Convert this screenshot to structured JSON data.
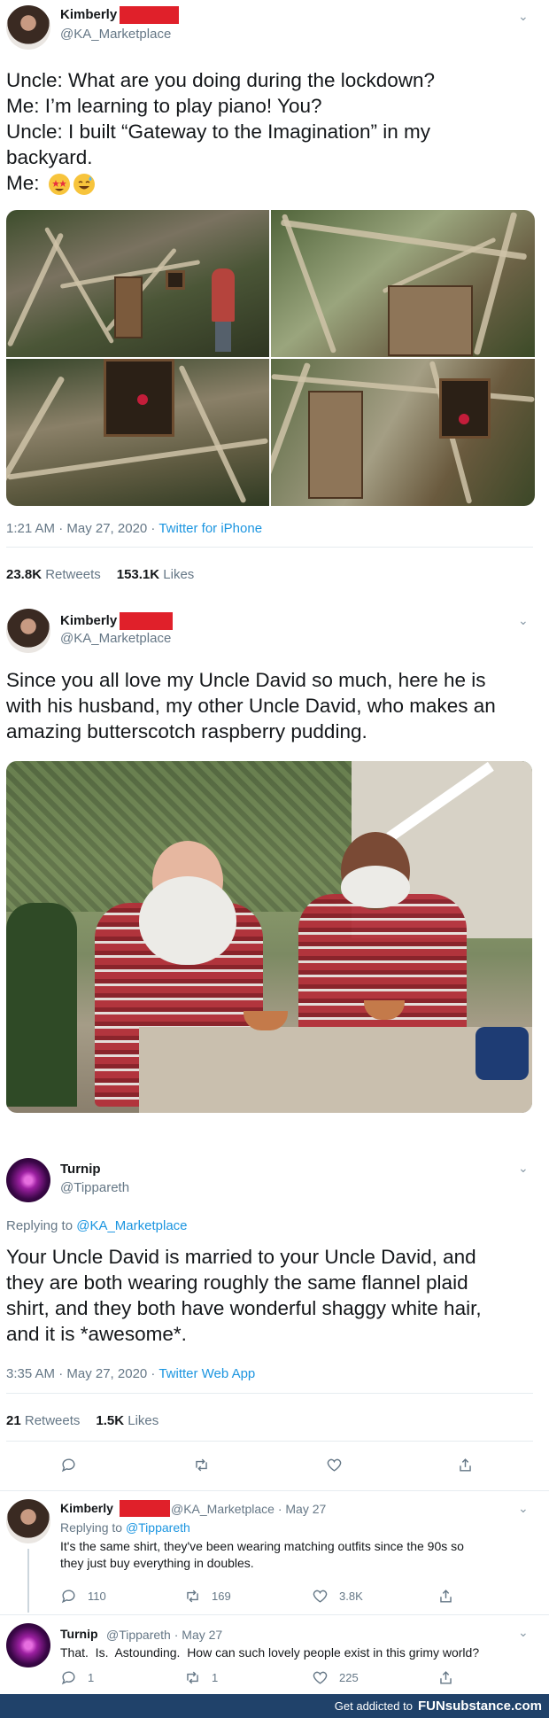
{
  "tweet1": {
    "name": "Kimberly",
    "handle": "@KA_Marketplace",
    "text": "Uncle: What are you doing during the lockdown?\nMe: I’m learning to play piano! You?\nUncle: I built “Gateway to the Imagination” in my\nbackyard.\nMe: ",
    "emojis": [
      "star-struck-emoji",
      "grinning-sweat-emoji"
    ],
    "time": "1:21 AM · May 27, 2020 · ",
    "source": "Twitter for iPhone",
    "retweets": "23.8K",
    "retweets_label": "Retweets",
    "likes": "153.1K",
    "likes_label": "Likes"
  },
  "tweet2": {
    "name": "Kimberly",
    "handle": "@KA_Marketplace",
    "text": "Since you all love my Uncle David so much, here he is\nwith his husband, my other Uncle David, who makes an\namazing butterscotch raspberry pudding."
  },
  "tweet3": {
    "name": "Turnip",
    "handle": "@Tippareth",
    "replying_prefix": "Replying to ",
    "replying_to": "@KA_Marketplace",
    "text": "Your Uncle David is married to your Uncle David, and\nthey are both wearing roughly the same flannel plaid\nshirt, and they both have wonderful shaggy white hair,\nand it is *awesome*.",
    "time": "3:35 AM · May 27, 2020 · ",
    "source": "Twitter Web App",
    "retweets": "21",
    "retweets_label": "Retweets",
    "likes": "1.5K",
    "likes_label": "Likes"
  },
  "reply1": {
    "name": "Kimberly",
    "handle_time": "@KA_Marketplace · May 27",
    "replying_prefix": "Replying to ",
    "replying_to": "@Tippareth",
    "text": "It's the same shirt, they've been wearing matching outfits since the 90s so\nthey just buy everything in doubles.",
    "replies": "110",
    "retweets": "169",
    "likes": "3.8K"
  },
  "reply2": {
    "name": "Turnip",
    "handle_time": "@Tippareth · May 27",
    "text": "That.  Is.  Astounding.  How can such lovely people exist in this grimy world?",
    "replies": "1",
    "retweets": "1",
    "likes": "225"
  },
  "footer": {
    "tagline": "Get addicted to",
    "brand": "FUNsubstance.com"
  },
  "colors": {
    "link": "#1b95e0",
    "redaction": "#e0202a",
    "footer": "#20426a"
  }
}
